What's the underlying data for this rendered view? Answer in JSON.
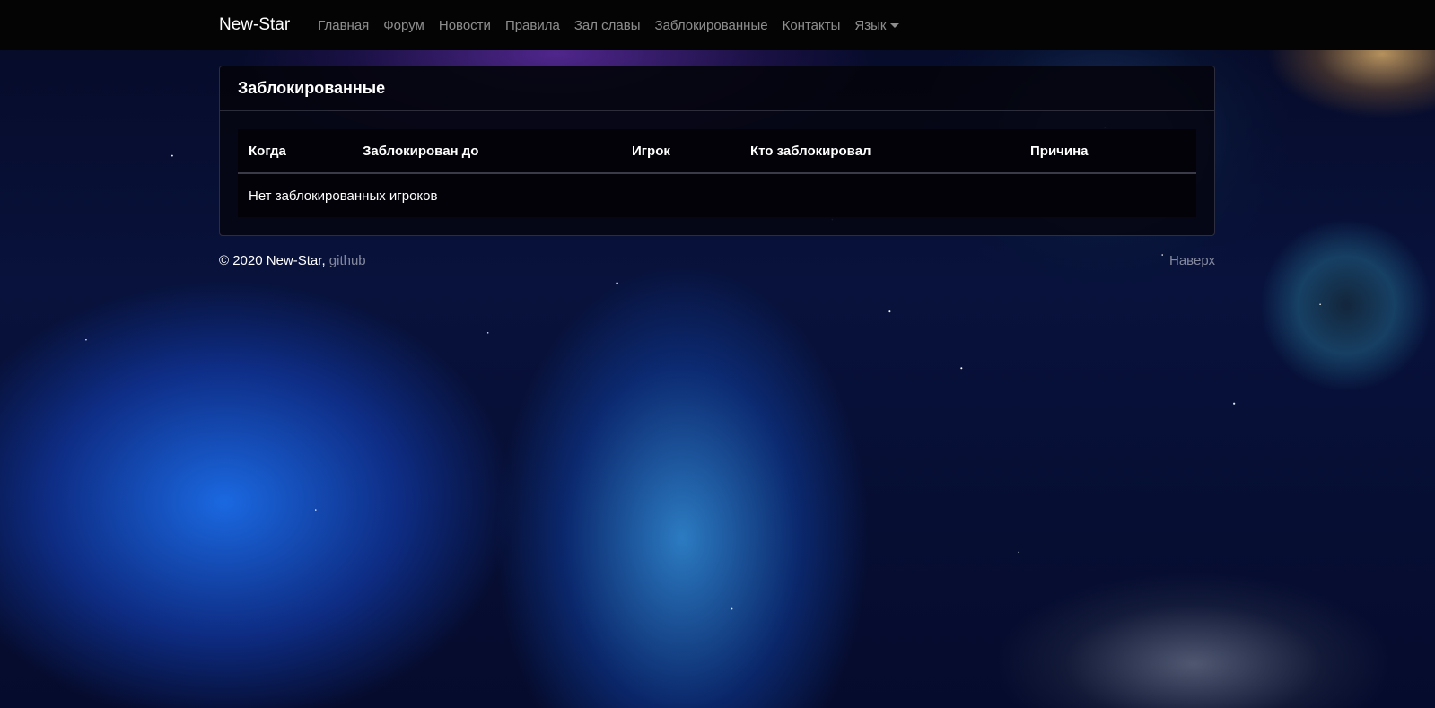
{
  "navbar": {
    "brand": "New-Star",
    "items": [
      {
        "label": "Главная"
      },
      {
        "label": "Форум"
      },
      {
        "label": "Новости"
      },
      {
        "label": "Правила"
      },
      {
        "label": "Зал славы"
      },
      {
        "label": "Заблокированные"
      },
      {
        "label": "Контакты"
      },
      {
        "label": "Язык"
      }
    ]
  },
  "card": {
    "title": "Заблокированные",
    "table": {
      "columns": [
        "Когда",
        "Заблокирован до",
        "Игрок",
        "Кто заблокировал",
        "Причина"
      ],
      "empty_message": "Нет заблокированных игроков"
    }
  },
  "footer": {
    "copyright": "© 2020 New-Star,",
    "github_link": "github",
    "back_to_top": "Наверх"
  }
}
